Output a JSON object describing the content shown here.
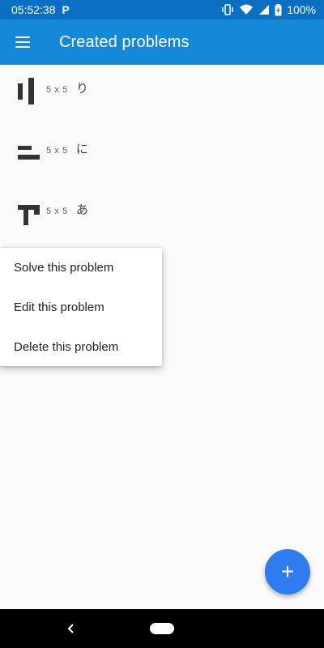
{
  "status_bar": {
    "time": "05:52:38",
    "notification_glyph": "P",
    "battery_percent": "100%",
    "icons": [
      "vibrate-icon",
      "wifi-icon",
      "signal-icon",
      "battery-charging-icon"
    ]
  },
  "app_bar": {
    "title": "Created problems",
    "menu_icon": "hamburger-menu-icon"
  },
  "problems": [
    {
      "size": "5 x 5",
      "name": "り",
      "thumbnail_icon": "puzzle-thumbnail-ri"
    },
    {
      "size": "5 x 5",
      "name": "に",
      "thumbnail_icon": "puzzle-thumbnail-ni"
    },
    {
      "size": "5 x 5",
      "name": "あ",
      "thumbnail_icon": "puzzle-thumbnail-a"
    }
  ],
  "context_menu": {
    "items": [
      {
        "label": "Solve this problem"
      },
      {
        "label": "Edit this problem"
      },
      {
        "label": "Delete this problem"
      }
    ]
  },
  "fab": {
    "glyph": "+",
    "icon": "add-icon"
  },
  "nav_bar": {
    "icons": [
      "back-icon",
      "home-pill-icon"
    ]
  },
  "colors": {
    "status_bar": "#0a6fc2",
    "app_bar": "#1688d8",
    "fab": "#2e7cf0",
    "background": "#fafafa"
  }
}
